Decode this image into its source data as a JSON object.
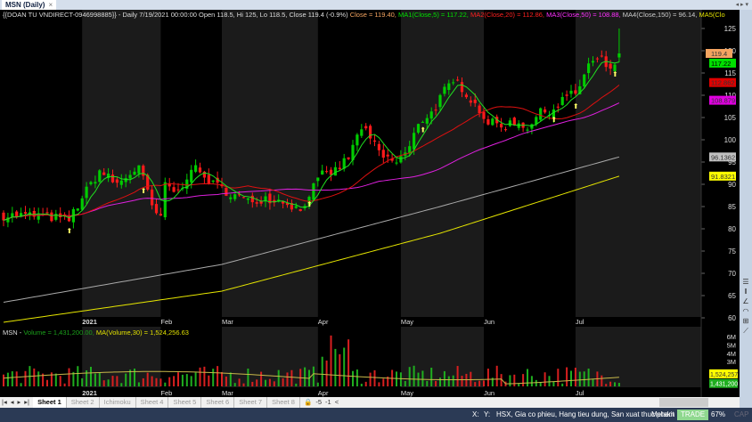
{
  "window": {
    "tab_title": "MSN (Daily)",
    "close": "×",
    "tab_controls": "◂ ▸ ▾"
  },
  "price_pane": {
    "legend": {
      "prefix": "{{DOAN TU VNDIRECT-0946998885}} - Daily 7/19/2021 00:00:00 Open 118.5, Hi 125, Lo 118.5, Close 119.4 (-0.9%)",
      "close": "Close = 119.40,",
      "ma1": "MA1(Close,5) = 117.22,",
      "ma2": "MA2(Close,20) = 112.86,",
      "ma3": "MA3(Close,50) = 108.88,",
      "ma4": "MA4(Close,150) = 96.14,",
      "ma5": "MA5(Clo"
    },
    "y_ticks": [
      125,
      120,
      115,
      110,
      105,
      100,
      95,
      90,
      85,
      80,
      75,
      70,
      65,
      60
    ],
    "badges": [
      {
        "text": "119.4",
        "color": "#f4a460",
        "value": 119.4
      },
      {
        "text": "117.22",
        "color": "#00e000",
        "value": 117.22
      },
      {
        "text": "112.862",
        "color": "#e00000",
        "value": 112.862
      },
      {
        "text": "108.879",
        "color": "#e000e0",
        "value": 108.879
      },
      {
        "text": "96.1362",
        "color": "#c0c0c0",
        "value": 96.1362
      },
      {
        "text": "91.8321",
        "color": "#ffff00",
        "value": 91.8321
      }
    ],
    "price_keypoints": [
      [
        0,
        83
      ],
      [
        8,
        83
      ],
      [
        15,
        82
      ],
      [
        18,
        87
      ],
      [
        22,
        93
      ],
      [
        26,
        90
      ],
      [
        31,
        94
      ],
      [
        34,
        85
      ],
      [
        36,
        82
      ],
      [
        37,
        90
      ],
      [
        40,
        88
      ],
      [
        43,
        94
      ],
      [
        48,
        90
      ],
      [
        52,
        88
      ],
      [
        56,
        86
      ],
      [
        60,
        87
      ],
      [
        65,
        86
      ],
      [
        68,
        84
      ],
      [
        70,
        88
      ],
      [
        73,
        92
      ],
      [
        76,
        93
      ],
      [
        79,
        96
      ],
      [
        82,
        103
      ],
      [
        84,
        100
      ],
      [
        87,
        96
      ],
      [
        90,
        95
      ],
      [
        93,
        98
      ],
      [
        95,
        104
      ],
      [
        98,
        106
      ],
      [
        101,
        111
      ],
      [
        104,
        113
      ],
      [
        108,
        108
      ],
      [
        111,
        104
      ],
      [
        114,
        103
      ],
      [
        117,
        104
      ],
      [
        120,
        103
      ],
      [
        123,
        106
      ],
      [
        126,
        107
      ],
      [
        129,
        110
      ],
      [
        131,
        110
      ],
      [
        134,
        117
      ],
      [
        137,
        118
      ],
      [
        139,
        115
      ],
      [
        141,
        119.4
      ]
    ],
    "ma4_keypoints": [
      [
        0,
        63.5
      ],
      [
        50,
        72
      ],
      [
        100,
        85
      ],
      [
        141,
        96.14
      ]
    ],
    "ma5_keypoints": [
      [
        0,
        59
      ],
      [
        50,
        66
      ],
      [
        100,
        79
      ],
      [
        141,
        91.83
      ]
    ]
  },
  "date_axis": [
    {
      "label": "2021",
      "bar": 18
    },
    {
      "label": "Feb",
      "bar": 36
    },
    {
      "label": "Mar",
      "bar": 50
    },
    {
      "label": "Apr",
      "bar": 72
    },
    {
      "label": "May",
      "bar": 91
    },
    {
      "label": "Jun",
      "bar": 110
    },
    {
      "label": "Jul",
      "bar": 131
    }
  ],
  "volume_pane": {
    "legend_prefix": "MSN -",
    "legend_vol": "Volume = 1,431,200.00,",
    "legend_ma": "MA(Volume,30) = 1,524,256.63",
    "y_ticks": [
      "6M",
      "5M",
      "4M",
      "3M"
    ],
    "y_values": [
      6,
      5,
      4,
      3
    ],
    "badge_ma": "1,524,257",
    "badge_vol": "1,431,200"
  },
  "sheets": {
    "nav": [
      "|◂",
      "◂",
      "▸",
      "▸|"
    ],
    "tabs": [
      "Sheet 1",
      "Sheet 2",
      "Ichimoku",
      "Sheet 4",
      "Sheet 5",
      "Sheet 6",
      "Sheet 7",
      "Sheet 8"
    ],
    "extra": [
      "🔒",
      "-5",
      "-1",
      "<"
    ]
  },
  "status": {
    "x": "X:",
    "y": "Y:",
    "info": "HSX, Gia co phieu, Hang tieu dung, San xuat thuc pham",
    "db": "Metakit",
    "mode": "TRADE",
    "zoom": "67%",
    "cap": "CAP"
  }
}
